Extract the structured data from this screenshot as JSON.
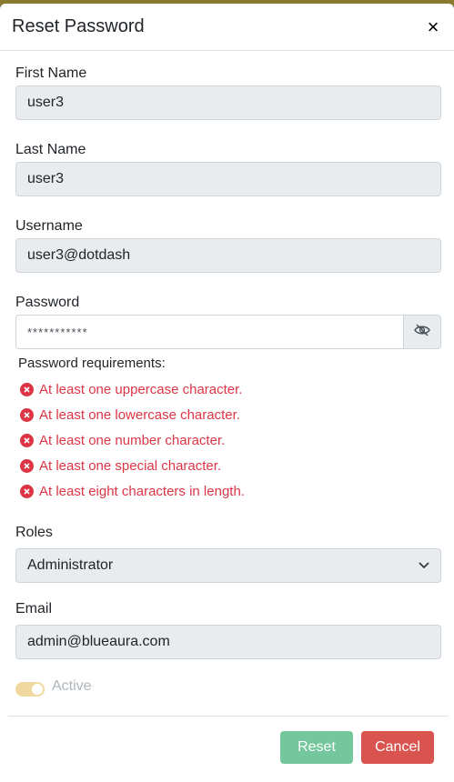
{
  "dialog": {
    "title": "Reset Password",
    "close_label": "×"
  },
  "fields": {
    "first_name": {
      "label": "First Name",
      "value": "user3"
    },
    "last_name": {
      "label": "Last Name",
      "value": "user3"
    },
    "username": {
      "label": "Username",
      "value": "user3@dotdash"
    },
    "password": {
      "label": "Password",
      "value": "***********"
    }
  },
  "requirements": {
    "title": "Password requirements:",
    "items": [
      "At least one uppercase character.",
      "At least one lowercase character.",
      "At least one number character.",
      "At least one special character.",
      "At least eight characters in length."
    ]
  },
  "roles": {
    "label": "Roles",
    "selected": "Administrator"
  },
  "email": {
    "label": "Email",
    "value": "admin@blueaura.com"
  },
  "active": {
    "label": "Active",
    "on": true
  },
  "buttons": {
    "reset": "Reset",
    "cancel": "Cancel"
  },
  "colors": {
    "error": "#dc3545",
    "reset_button": "#74c69d",
    "cancel_button": "#d9534f",
    "toggle": "#f0d9a0"
  },
  "icons": {
    "close": "close-icon",
    "password_toggle": "eye-slash-icon",
    "requirement_status": "x-circle-icon",
    "roles_dropdown": "chevron-down-icon"
  }
}
